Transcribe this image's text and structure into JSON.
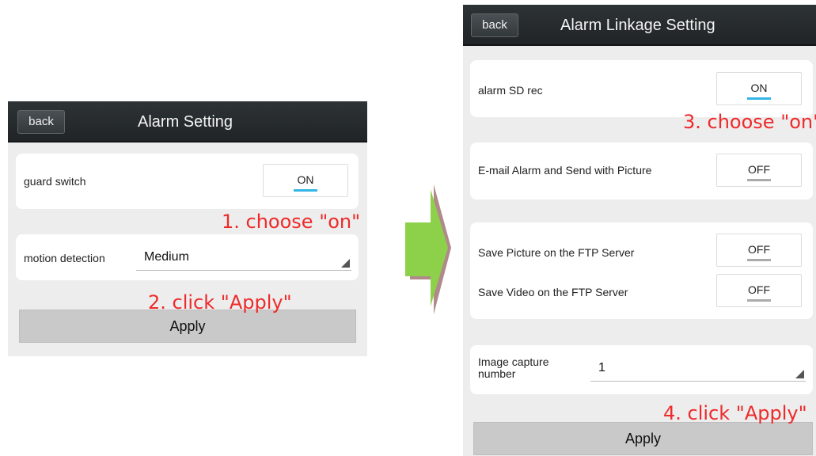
{
  "left_screen": {
    "back_label": "back",
    "title": "Alarm Setting",
    "guard_switch": {
      "label": "guard switch",
      "value": "ON"
    },
    "motion_detection": {
      "label": "motion detection",
      "value": "Medium"
    },
    "apply_label": "Apply"
  },
  "right_screen": {
    "back_label": "back",
    "title": "Alarm Linkage Setting",
    "alarm_sd_rec": {
      "label": "alarm SD rec",
      "value": "ON"
    },
    "email_alarm": {
      "label": "E-mail Alarm and Send with Picture",
      "value": "OFF"
    },
    "save_picture_ftp": {
      "label": "Save Picture on the FTP Server",
      "value": "OFF"
    },
    "save_video_ftp": {
      "label": "Save Video on the FTP Server",
      "value": "OFF"
    },
    "image_capture": {
      "label_line1": "Image capture",
      "label_line2": "number",
      "value": "1"
    },
    "apply_label": "Apply"
  },
  "annotations": {
    "step1": "1. choose \"on\"",
    "step2": "2. click \"Apply\"",
    "step3": "3. choose \"on\"",
    "step4": "4. click \"Apply\""
  },
  "colors": {
    "annotation": "#ee2a2a",
    "toggle_on_indicator": "#33b5e5",
    "arrow_fill": "#8dd14a",
    "arrow_shadow": "#b08a8a"
  },
  "icons": {
    "arrow": "right-arrow-icon",
    "dropdown": "dropdown-caret-icon"
  }
}
